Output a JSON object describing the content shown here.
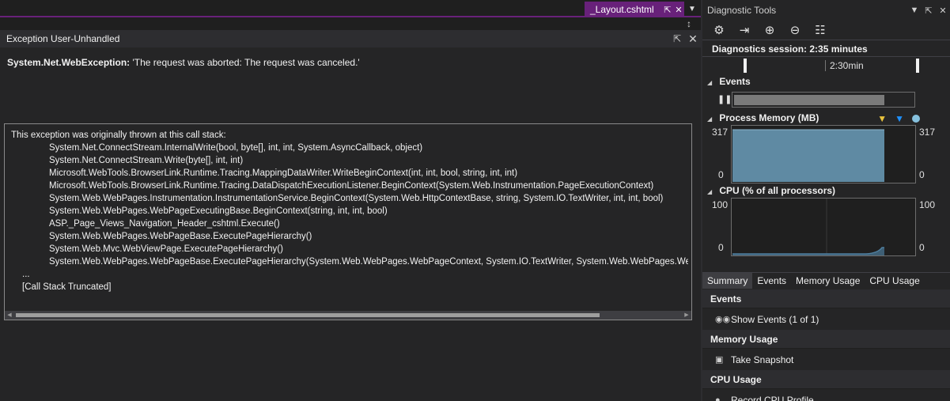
{
  "editor": {
    "doc_tab": {
      "title": "_Layout.cshtml",
      "pin_icon": "pin-icon",
      "close_icon": "close-icon"
    },
    "overflow_icon": "chevron-down-icon"
  },
  "exception": {
    "title": "Exception User-Unhandled",
    "type": "System.Net.WebException:",
    "message": "'The request was aborted: The request was canceled.'",
    "stack_header": "This exception was originally thrown at this call stack:",
    "frames": [
      "System.Net.ConnectStream.InternalWrite(bool, byte[], int, int, System.AsyncCallback, object)",
      "System.Net.ConnectStream.Write(byte[], int, int)",
      "Microsoft.WebTools.BrowserLink.Runtime.Tracing.MappingDataWriter.WriteBeginContext(int, int, bool, string, int, int)",
      "Microsoft.WebTools.BrowserLink.Runtime.Tracing.DataDispatchExecutionListener.BeginContext(System.Web.Instrumentation.PageExecutionContext)",
      "System.Web.WebPages.Instrumentation.InstrumentationService.BeginContext(System.Web.HttpContextBase, string, System.IO.TextWriter, int, int, bool)",
      "System.Web.WebPages.WebPageExecutingBase.BeginContext(string, int, int, bool)",
      "ASP._Page_Views_Navigation_Header_cshtml.Execute()",
      "System.Web.WebPages.WebPageBase.ExecutePageHierarchy()",
      "System.Web.Mvc.WebViewPage.ExecutePageHierarchy()",
      "System.Web.WebPages.WebPageBase.ExecutePageHierarchy(System.Web.WebPages.WebPageContext, System.IO.TextWriter, System.Web.WebPages.WebP"
    ],
    "ellipsis": "...",
    "truncated": "[Call Stack Truncated]"
  },
  "diagnostics": {
    "title": "Diagnostic Tools",
    "session": "Diagnostics session: 2:35 minutes",
    "ruler_label": "2:30min",
    "events_label": "Events",
    "memory": {
      "label": "Process Memory (MB)",
      "max": "317",
      "min": "0"
    },
    "cpu": {
      "label": "CPU (% of all processors)",
      "max": "100",
      "min": "0"
    },
    "tabs": [
      "Summary",
      "Events",
      "Memory Usage",
      "CPU Usage"
    ],
    "summary": {
      "events_head": "Events",
      "show_events": "Show Events (1 of 1)",
      "memory_head": "Memory Usage",
      "take_snapshot": "Take Snapshot",
      "cpu_head": "CPU Usage",
      "record_cpu": "Record CPU Profile"
    }
  },
  "colors": {
    "accent": "#68217a",
    "memory_fill": "#5f8aa3",
    "cpu_line": "#4f7f9f"
  }
}
